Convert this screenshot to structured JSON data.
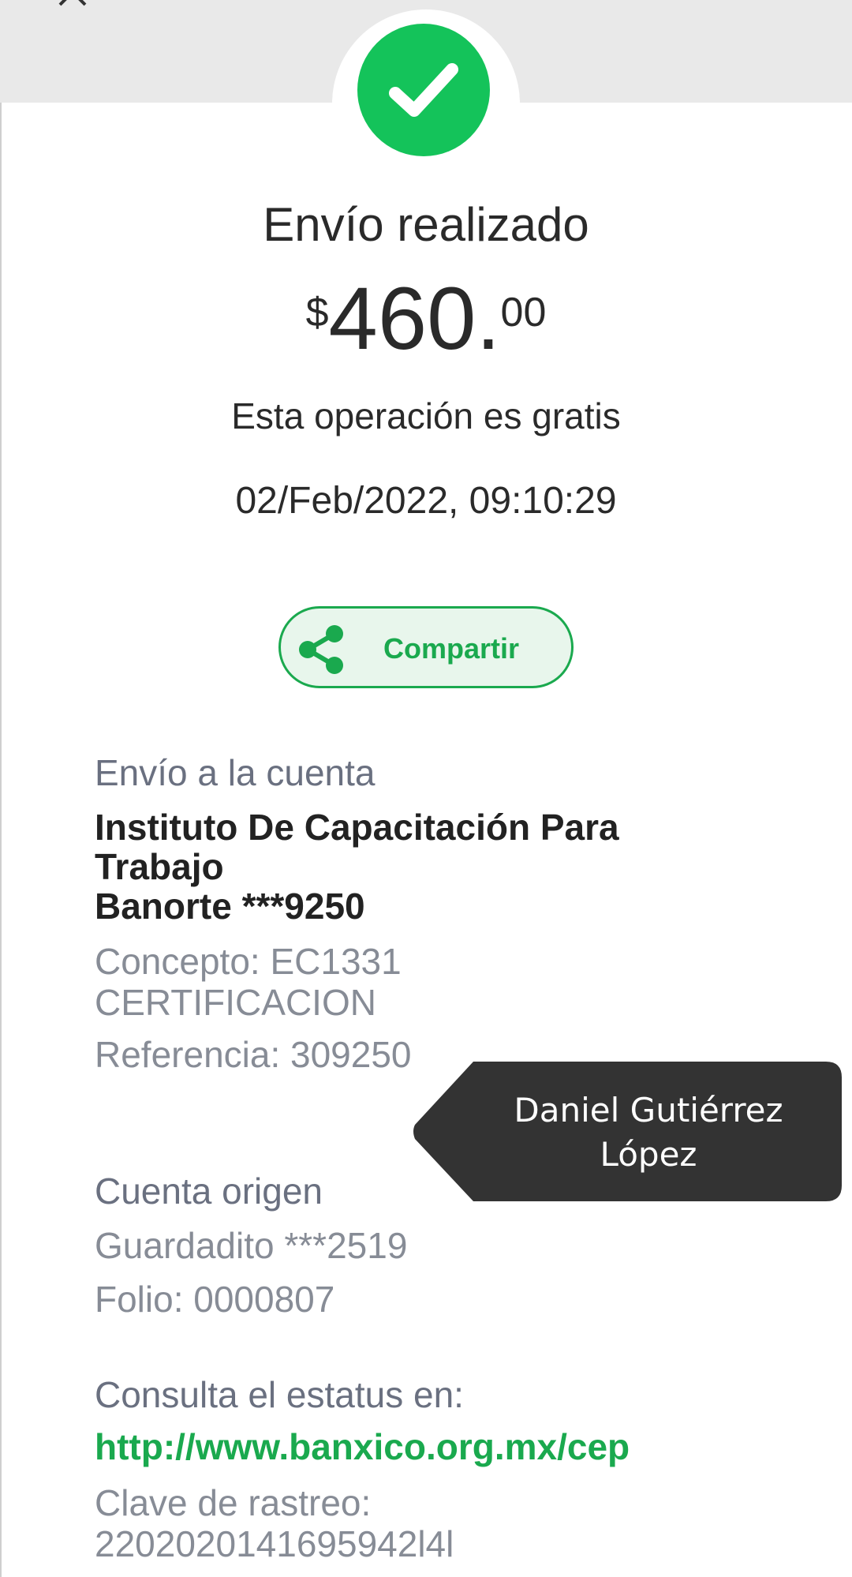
{
  "status": {
    "title": "Envío realizado",
    "amount_currency": "$",
    "amount_integer": "460.",
    "amount_decimals": "00",
    "fee_note": "Esta operación es gratis",
    "datetime": "02/Feb/2022, 09:10:29"
  },
  "share_button": {
    "label": "Compartir"
  },
  "destination": {
    "section_label": "Envío a la cuenta",
    "name_line1": "Instituto De Capacitación Para",
    "name_line2": "Trabajo",
    "bank_account": "Banorte ***9250",
    "concept_line1": "Concepto: EC1331",
    "concept_line2": "CERTIFICACION",
    "reference": "Referencia: 309250"
  },
  "origin": {
    "section_label": "Cuenta origen",
    "account": "Guardadito  ***2519",
    "folio": "Folio: 0000807"
  },
  "status_check": {
    "label": "Consulta el estatus en:",
    "url": "http://www.banxico.org.mx/cep",
    "tracking_label": "Clave de rastreo:",
    "tracking_code": "2202020141695942l4l"
  },
  "tooltip": {
    "line1": "Daniel Gutiérrez",
    "line2": "López"
  },
  "icons": {
    "close": "close-icon",
    "success": "checkmark-icon",
    "share": "share-icon"
  },
  "colors": {
    "accent_green": "#1aa94e",
    "success_badge": "#14c35a",
    "tooltip_bg": "#333333",
    "secondary_text": "#878c96"
  }
}
